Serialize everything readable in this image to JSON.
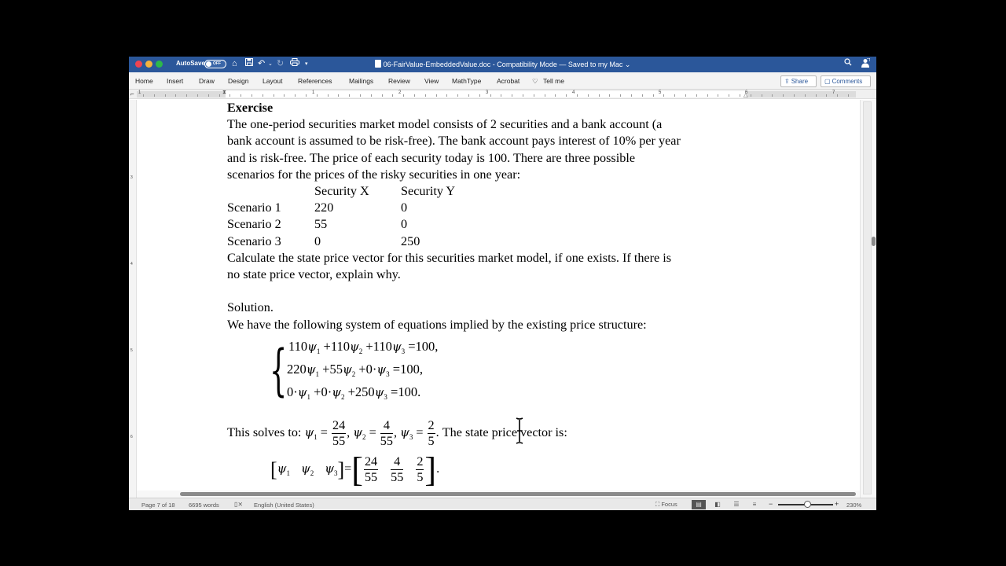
{
  "titlebar": {
    "autosave_label": "AutoSave",
    "autosave_state": "OFF",
    "doc_title": "06-FairValue-EmbeddedValue.doc  -  Compatibility Mode — Saved to my Mac ⌄",
    "icons": [
      "home-icon",
      "save-icon",
      "undo-icon",
      "redo-icon",
      "print-icon",
      "customize-toolbar-icon",
      "search-icon",
      "share-person-icon"
    ]
  },
  "ribbon": {
    "tabs": [
      "Home",
      "Insert",
      "Draw",
      "Design",
      "Layout",
      "References",
      "Mailings",
      "Review",
      "View",
      "MathType",
      "Acrobat",
      "Tell me"
    ],
    "share_label": "Share",
    "comments_label": "Comments"
  },
  "ruler": {
    "numbers": [
      "1",
      "1",
      "2",
      "3",
      "4",
      "5",
      "6",
      "7"
    ]
  },
  "vruler": {
    "numbers": [
      "3",
      "4",
      "5",
      "6"
    ]
  },
  "document": {
    "heading": "Exercise",
    "intro_lines": [
      "The one-period securities market model consists of 2 securities and a bank account (a",
      "bank account is assumed to be risk-free). The bank account pays interest of 10% per year",
      "and is risk-free. The price of each security today is 100. There are three possible",
      "scenarios for the prices of the risky securities in one year:"
    ],
    "table": {
      "headers": [
        "",
        "Security X",
        "Security Y"
      ],
      "rows": [
        [
          "Scenario 1",
          "220",
          "0"
        ],
        [
          "Scenario 2",
          "55",
          "0"
        ],
        [
          "Scenario 3",
          "0",
          "250"
        ]
      ]
    },
    "question_lines": [
      "Calculate the state price vector for this securities market model, if one exists. If there is",
      "no state price vector, explain why."
    ],
    "solution_label": "Solution.",
    "solution_intro": "We have the following system of equations implied by the existing price structure:",
    "equations": {
      "eq1": [
        "110",
        "+110",
        "+110",
        "=100,"
      ],
      "eq2": [
        "220",
        "+55",
        "+0·",
        "=100,"
      ],
      "eq3": [
        "0·",
        "+0·",
        "+250",
        "=100."
      ]
    },
    "psi": "ψ",
    "solves_prefix": "This solves to:",
    "solution_values": {
      "psi1": {
        "num": "24",
        "den": "55"
      },
      "psi2": {
        "num": "4",
        "den": "55"
      },
      "psi3": {
        "num": "2",
        "den": "5"
      }
    },
    "solves_suffix": ". The state price vector is:",
    "vector_end": "."
  },
  "statusbar": {
    "page": "Page 7 of 18",
    "words": "6695 words",
    "language": "English (United States)",
    "focus_label": "Focus",
    "zoom_level": "230%",
    "zoom_fraction": 0.53
  }
}
